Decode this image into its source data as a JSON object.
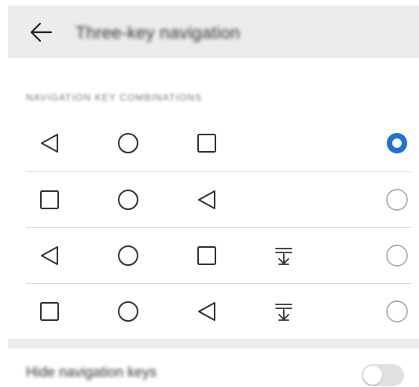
{
  "header": {
    "title": "Three-key navigation",
    "back_icon": "arrow-left-icon"
  },
  "section": {
    "label": "NAVIGATION KEY COMBINATIONS"
  },
  "options": [
    {
      "keys": [
        "back",
        "home",
        "recents"
      ],
      "selected": true
    },
    {
      "keys": [
        "recents",
        "home",
        "back"
      ],
      "selected": false
    },
    {
      "keys": [
        "back",
        "home",
        "recents",
        "notification"
      ],
      "selected": false
    },
    {
      "keys": [
        "recents",
        "home",
        "back",
        "notification"
      ],
      "selected": false
    }
  ],
  "hide_keys": {
    "label": "Hide navigation keys",
    "enabled": false
  },
  "colors": {
    "accent": "#1d72d9",
    "header_bg": "#ececec",
    "icon": "#333333",
    "radio_off": "#9a9a9a",
    "divider": "#d9d9d9"
  }
}
